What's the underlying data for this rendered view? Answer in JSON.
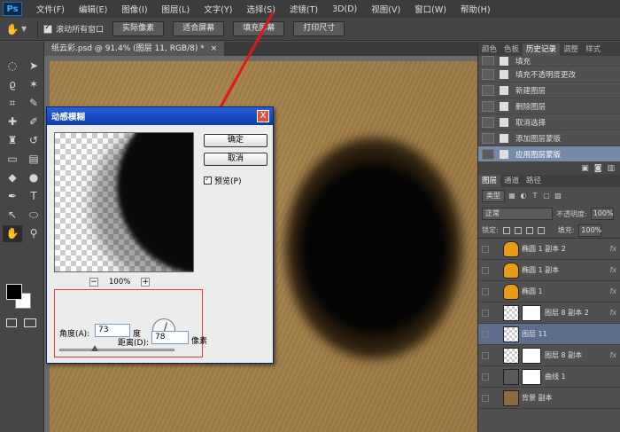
{
  "app": {
    "logo": "Ps"
  },
  "menu": [
    "文件(F)",
    "编辑(E)",
    "图像(I)",
    "图层(L)",
    "文字(Y)",
    "选择(S)",
    "滤镜(T)",
    "3D(D)",
    "视图(V)",
    "窗口(W)",
    "帮助(H)"
  ],
  "options": {
    "all_windows_label": "滚动所有窗口",
    "actual_pixels": "实际像素",
    "fit_screen": "适合屏幕",
    "fill_screen": "填充屏幕",
    "print_size": "打印尺寸"
  },
  "document": {
    "tab_title": "纸云彩.psd @ 91.4% (图层 11, RGB/8) *",
    "close": "×"
  },
  "dialog": {
    "title": "动感模糊",
    "close": "X",
    "ok": "确定",
    "cancel": "取消",
    "preview_label": "预览(P)",
    "zoom": "100%",
    "zoom_out": "−",
    "zoom_in": "+",
    "angle_label": "角度(A):",
    "angle_value": "73",
    "angle_unit": "度",
    "distance_label": "距离(D):",
    "distance_value": "78",
    "distance_unit": "像素"
  },
  "history_panel": {
    "tabs": [
      "颜色",
      "色板",
      "历史记录",
      "调整",
      "样式"
    ],
    "items": [
      {
        "label": "填充"
      },
      {
        "label": "填充不透明度更改"
      },
      {
        "label": "新建图层"
      },
      {
        "label": "删除图层"
      },
      {
        "label": "取消选择"
      },
      {
        "label": "添加图层蒙版"
      },
      {
        "label": "应用图层蒙版"
      }
    ]
  },
  "layers_panel": {
    "tabs": [
      "图层",
      "通道",
      "路径"
    ],
    "filter": "类型",
    "blend_mode": "正常",
    "opacity_label": "不透明度:",
    "opacity_value": "100%",
    "lock_label": "锁定:",
    "fill_label": "填充:",
    "fill_value": "100%",
    "layers": [
      {
        "name": "椭圆 1 副本 2",
        "fx": "fx"
      },
      {
        "name": "椭圆 1 副本",
        "fx": "fx"
      },
      {
        "name": "椭圆 1",
        "fx": "fx"
      },
      {
        "name": "图层 8 副本 2",
        "fx": "fx"
      },
      {
        "name": "图层 11",
        "fx": ""
      },
      {
        "name": "图层 8 副本",
        "fx": "fx"
      },
      {
        "name": "曲线 1",
        "fx": ""
      },
      {
        "name": "背景 副本",
        "fx": ""
      }
    ]
  },
  "colors": {
    "accent": "#d82020",
    "selected": "#7589a8"
  }
}
